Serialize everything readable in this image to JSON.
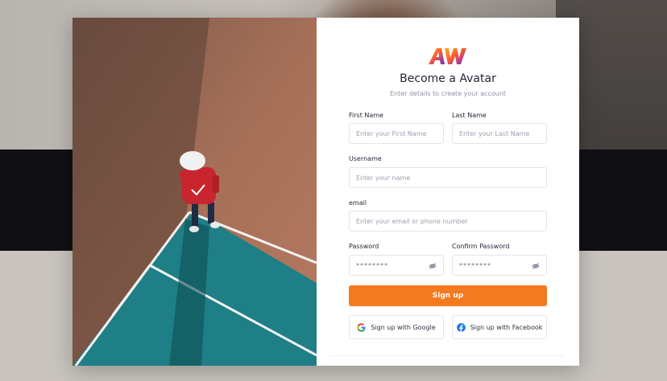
{
  "brand": {
    "logo_text": "AW",
    "accent_color": "#f47a1f"
  },
  "header": {
    "title": "Become a Avatar",
    "subtitle": "Enter details to create your account"
  },
  "form": {
    "first_name": {
      "label": "First Name",
      "placeholder": "Enter your First Name"
    },
    "last_name": {
      "label": "Last Name",
      "placeholder": "Enter your Last Name"
    },
    "username": {
      "label": "Username",
      "placeholder": "Enter your name"
    },
    "email": {
      "label": "email",
      "placeholder": "Enter your email or phone number"
    },
    "password": {
      "label": "Password",
      "value": "********"
    },
    "confirm_password": {
      "label": "Confirm Password",
      "value": "********"
    },
    "submit_label": "Sign up"
  },
  "social": {
    "google_label": "Sign up with Google",
    "facebook_label": "Sign up with Facebook"
  },
  "icons": [
    "google-icon",
    "facebook-icon",
    "eye-off-icon"
  ]
}
